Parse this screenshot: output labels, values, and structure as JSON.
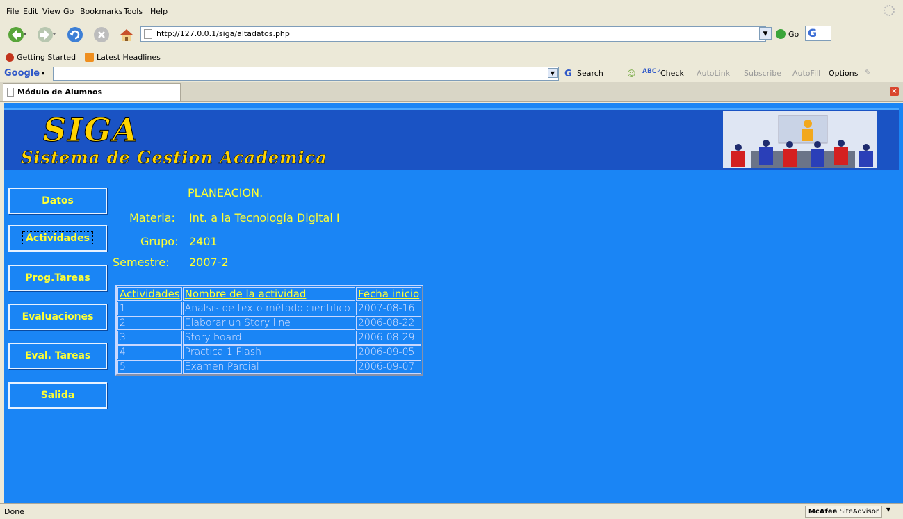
{
  "browser": {
    "menu": [
      "File",
      "Edit",
      "View",
      "Go",
      "Bookmarks",
      "Tools",
      "Help"
    ],
    "url": "http://127.0.0.1/siga/altadatos.php",
    "go_label": "Go",
    "bookmarks": [
      "Getting Started",
      "Latest Headlines"
    ],
    "google_toolbar": {
      "logo": "Google",
      "search": "Search",
      "check": "Check",
      "autolink": "AutoLink",
      "subscribe": "Subscribe",
      "autofill": "AutoFill",
      "options": "Options"
    },
    "tab_title": "Módulo de Alumnos",
    "status": "Done",
    "mcafee": "McAfee",
    "siteadvisor": "SiteAdvisor"
  },
  "page": {
    "logo": "SIGA",
    "subtitle": "Sistema de Gestion Academica",
    "nav": [
      "Datos",
      "Actividades",
      "Prog.Tareas",
      "Evaluaciones",
      "Eval. Tareas",
      "Salida"
    ],
    "heading": "PLANEACION.",
    "materia_label": "Materia:",
    "materia_value": "Int. a la Tecnología Digital I",
    "grupo_label": "Grupo:",
    "grupo_value": "2401",
    "semestre_label": "Semestre:",
    "semestre_value": "2007-2",
    "table": {
      "headers": [
        "Actividades",
        "Nombre de la actividad",
        "Fecha inicio"
      ],
      "rows": [
        [
          "1",
          "Analsis de texto método cientifico.",
          "2007-08-16"
        ],
        [
          "2",
          "Elaborar un Story line",
          "2006-08-22"
        ],
        [
          "3",
          "Story board",
          "2006-08-29"
        ],
        [
          "4",
          "Practica 1 Flash",
          "2006-09-05"
        ],
        [
          "5",
          "Examen Parcial",
          "2006-09-07"
        ]
      ]
    }
  },
  "colors": {
    "page_bg": "#1a85f5",
    "banner_bg": "#1a53c4",
    "accent_text": "#ffff33",
    "logo": "#ffd400"
  }
}
